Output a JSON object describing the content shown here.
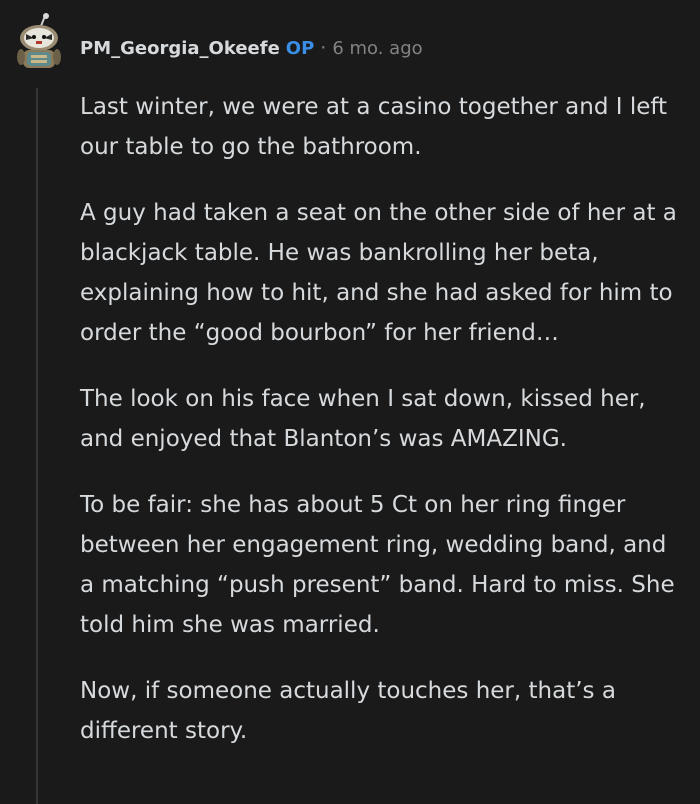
{
  "comment": {
    "author": "PM_Georgia_Okeefe",
    "badge": "OP",
    "separator": "·",
    "timestamp": "6 mo. ago",
    "avatar_icon": "snoo-avatar-icon",
    "paragraphs": [
      "Last winter, we were at a casino together and I left our table to go the bathroom.",
      "A guy had taken a seat on the other side of her at a blackjack table. He was bankrolling her beta, explaining how to hit, and she had asked for him to order the “good bourbon” for her friend…",
      "The look on his face when I sat down, kissed her, and enjoyed that Blanton’s was AMAZING.",
      "To be fair: she has about 5 Ct on her ring finger between her engagement ring, wedding band, and a matching “push present” band. Hard to miss. She told him she was married.",
      "Now, if someone actually touches her, that’s a different story."
    ]
  },
  "colors": {
    "background": "#1a1a1b",
    "text": "#d7dadc",
    "muted": "#818384",
    "op_badge": "#3a8ee6",
    "thread_line": "#343536"
  }
}
